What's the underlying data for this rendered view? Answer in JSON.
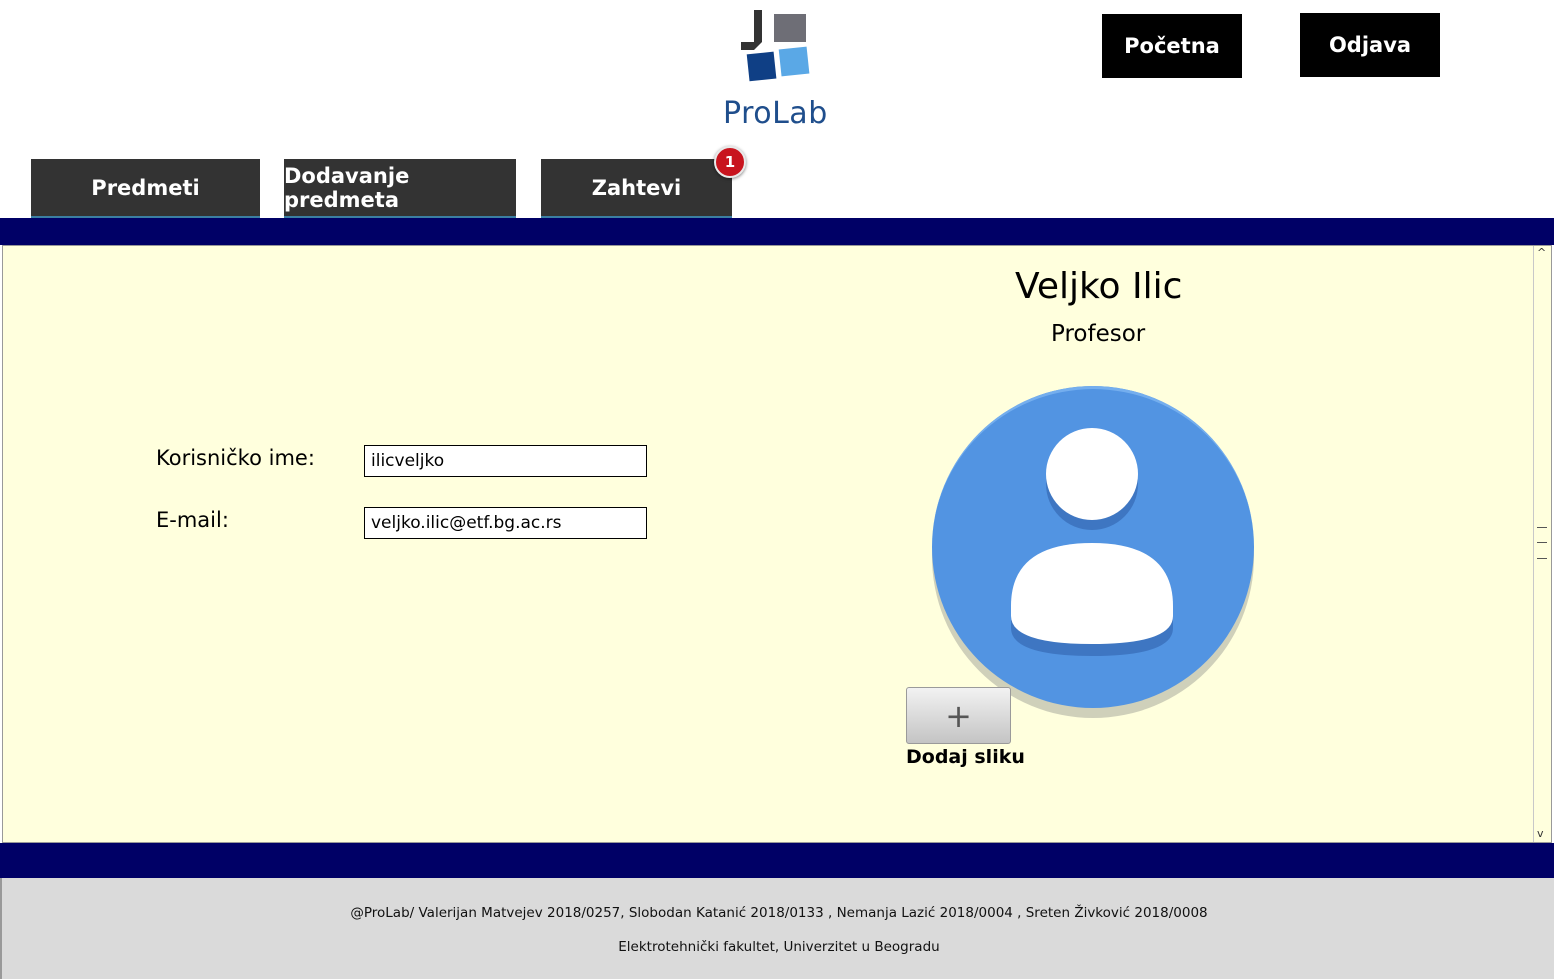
{
  "header": {
    "logo_text": "ProLab",
    "home_button": "Početna",
    "logout_button": "Odjava"
  },
  "tabs": [
    {
      "label": "Predmeti"
    },
    {
      "label": "Dodavanje predmeta"
    },
    {
      "label": "Zahtevi",
      "badge": "1"
    }
  ],
  "profile": {
    "name": "Veljko Ilic",
    "role": "Profesor",
    "username_label": "Korisničko ime:",
    "username": "ilicveljko",
    "email_label": "E-mail:",
    "email": "veljko.ilic@etf.bg.ac.rs",
    "add_photo_label": "Dodaj sliku"
  },
  "footer": {
    "line1": "@ProLab/ Valerijan Matvejev 2018/0257, Slobodan Katanić 2018/0133 , Nemanja Lazić 2018/0004 , Sreten Živković 2018/0008",
    "line2": "Elektrotehnički fakultet, Univerzitet u Beogradu"
  },
  "colors": {
    "navy_band": "#000066",
    "panel_background": "#ffffdd",
    "tab_background": "#333333",
    "avatar_blue": "#5294e2",
    "badge_red": "#c8141e"
  }
}
